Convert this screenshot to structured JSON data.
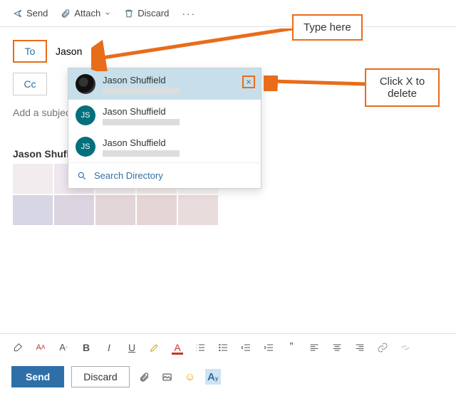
{
  "top_toolbar": {
    "send": "Send",
    "attach": "Attach",
    "discard": "Discard"
  },
  "fields": {
    "to_label": "To",
    "to_value": "Jason",
    "cc_label": "Cc",
    "subject_placeholder": "Add a subject"
  },
  "autocomplete": {
    "items": [
      {
        "name": "Jason Shuffield",
        "initials": "",
        "avatar_type": "photo"
      },
      {
        "name": "Jason Shuffield",
        "initials": "JS",
        "avatar_type": "teal"
      },
      {
        "name": "Jason Shuffield",
        "initials": "JS",
        "avatar_type": "teal"
      }
    ],
    "search_directory": "Search Directory"
  },
  "body": {
    "visible_text": "Jason Shufl"
  },
  "callouts": {
    "type_here": "Type here",
    "click_x_line1": "Click X to",
    "click_x_line2": "delete"
  },
  "bottom_bar": {
    "send": "Send",
    "discard": "Discard"
  },
  "swatch_colors": {
    "row1": [
      "#f2ecef",
      "#efe7ee",
      "#f4eeee",
      "#f8ecec",
      "#f9f3f2"
    ],
    "row2": [
      "#d6d6e4",
      "#dcd4e0",
      "#e3d6d8",
      "#e6d5d5",
      "#e9dcdc"
    ]
  },
  "accent_orange": "#e86c1a"
}
